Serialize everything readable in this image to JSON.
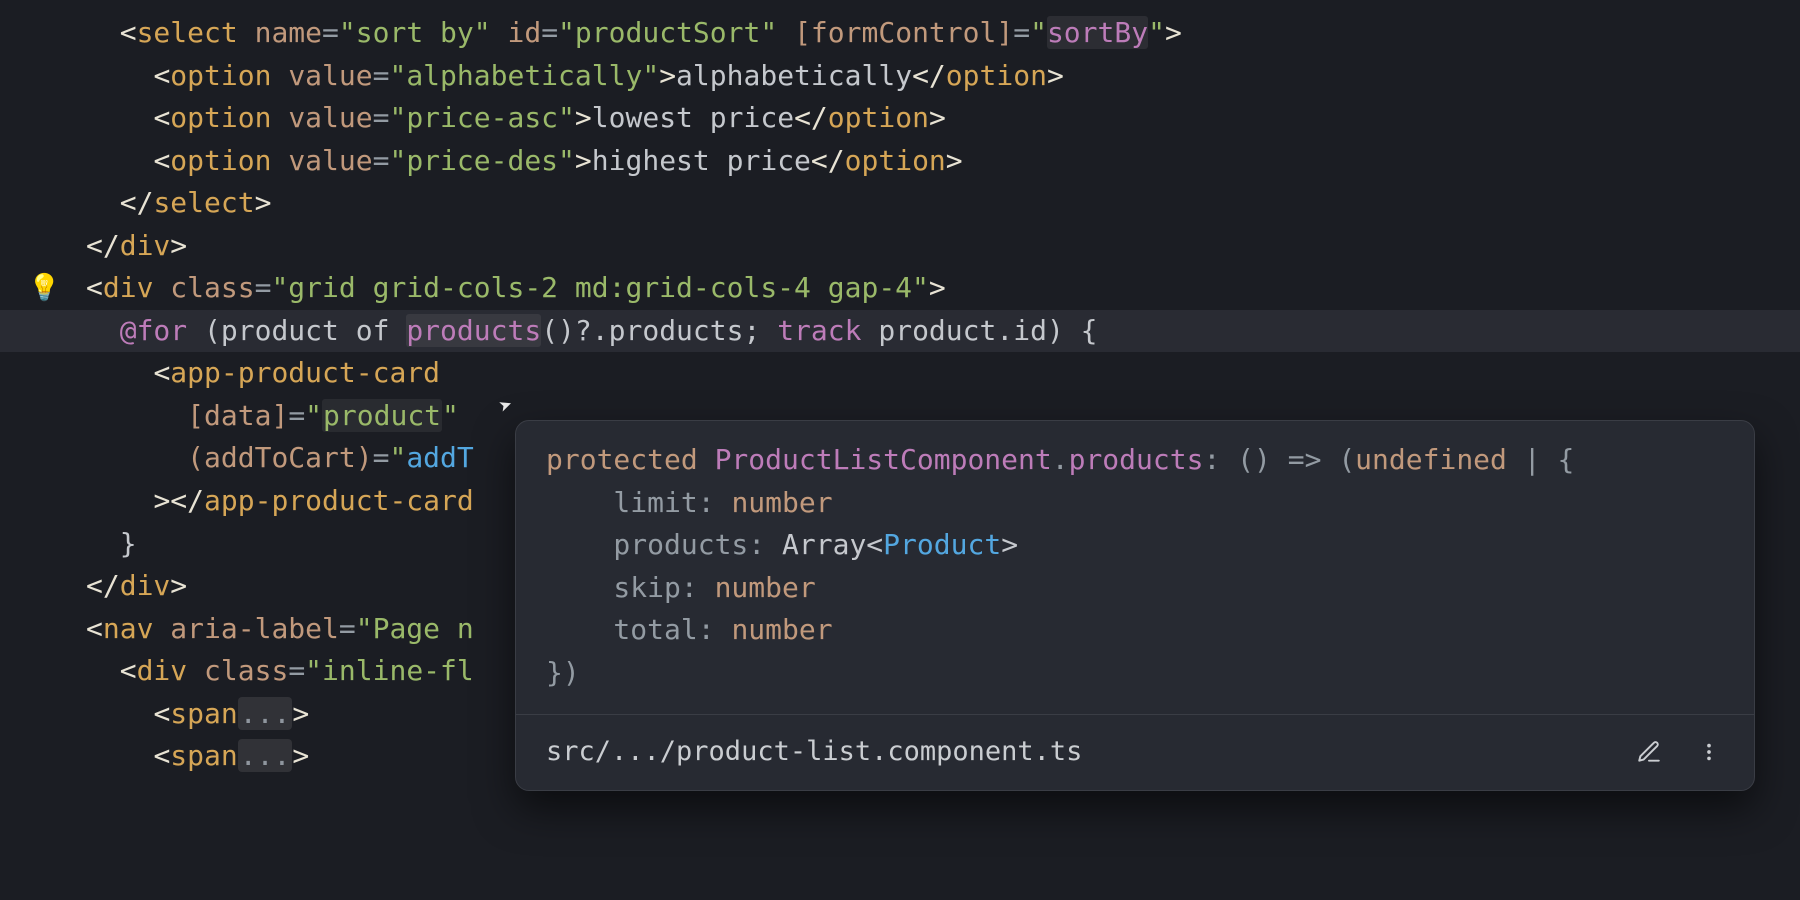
{
  "code": {
    "select_open_1": "<",
    "select_tag": "select",
    "select_name_attr": "name",
    "select_name_val": "\"sort by\"",
    "select_id_attr": "id",
    "select_id_val": "\"productSort\"",
    "select_fc_attr": "[formControl]",
    "select_fc_val": "\"",
    "select_fc_ident": "sortBy",
    "select_fc_val2": "\"",
    "option_tag": "option",
    "option_value_attr": "value",
    "opt1_val": "\"alphabetically\"",
    "opt1_text": "alphabetically",
    "opt2_val": "\"price-asc\"",
    "opt2_text": "lowest price",
    "opt3_val": "\"price-des\"",
    "opt3_text": "highest price",
    "div_tag": "div",
    "div_class_attr": "class",
    "div_class_val": "\"grid grid-cols-2 md:grid-cols-4 gap-4\"",
    "for_at": "@for",
    "for_lp": " (",
    "for_product": "product",
    "for_of": " of ",
    "for_products": "products",
    "for_call": "()?.",
    "for_productsprop": "products",
    "for_semi": "; ",
    "for_track": "track",
    "for_space": " ",
    "for_pid": "product.id",
    "for_rp": ") {",
    "card_tag": "app-product-card",
    "data_attr": "[data]",
    "data_val": "\"",
    "data_ident": "product",
    "data_val2": "\"",
    "addcart_attr": "(addToCart)",
    "addcart_val": "\"",
    "addcart_ident": "addT",
    "close_brace": "}",
    "nav_tag": "nav",
    "nav_arialabel_attr": "aria-label",
    "nav_arialabel_val": "\"Page n",
    "inner_div_class_attr": "class",
    "inner_div_class_val": "\"inline-fl",
    "span_tag": "span",
    "fold": "..."
  },
  "hover": {
    "protected": "protected",
    "class": "ProductListComponent",
    "dot": ".",
    "member": "products",
    "sig1": ": () => (",
    "undef": "undefined",
    "sig2": " | {",
    "limit_k": "    limit",
    "colon": ": ",
    "number": "number",
    "products_k": "    products",
    "arr1": "Array<",
    "product_t": "Product",
    "arr2": ">",
    "skip_k": "    skip",
    "total_k": "    total",
    "close": "})",
    "path": "src/.../product-list.component.ts"
  }
}
